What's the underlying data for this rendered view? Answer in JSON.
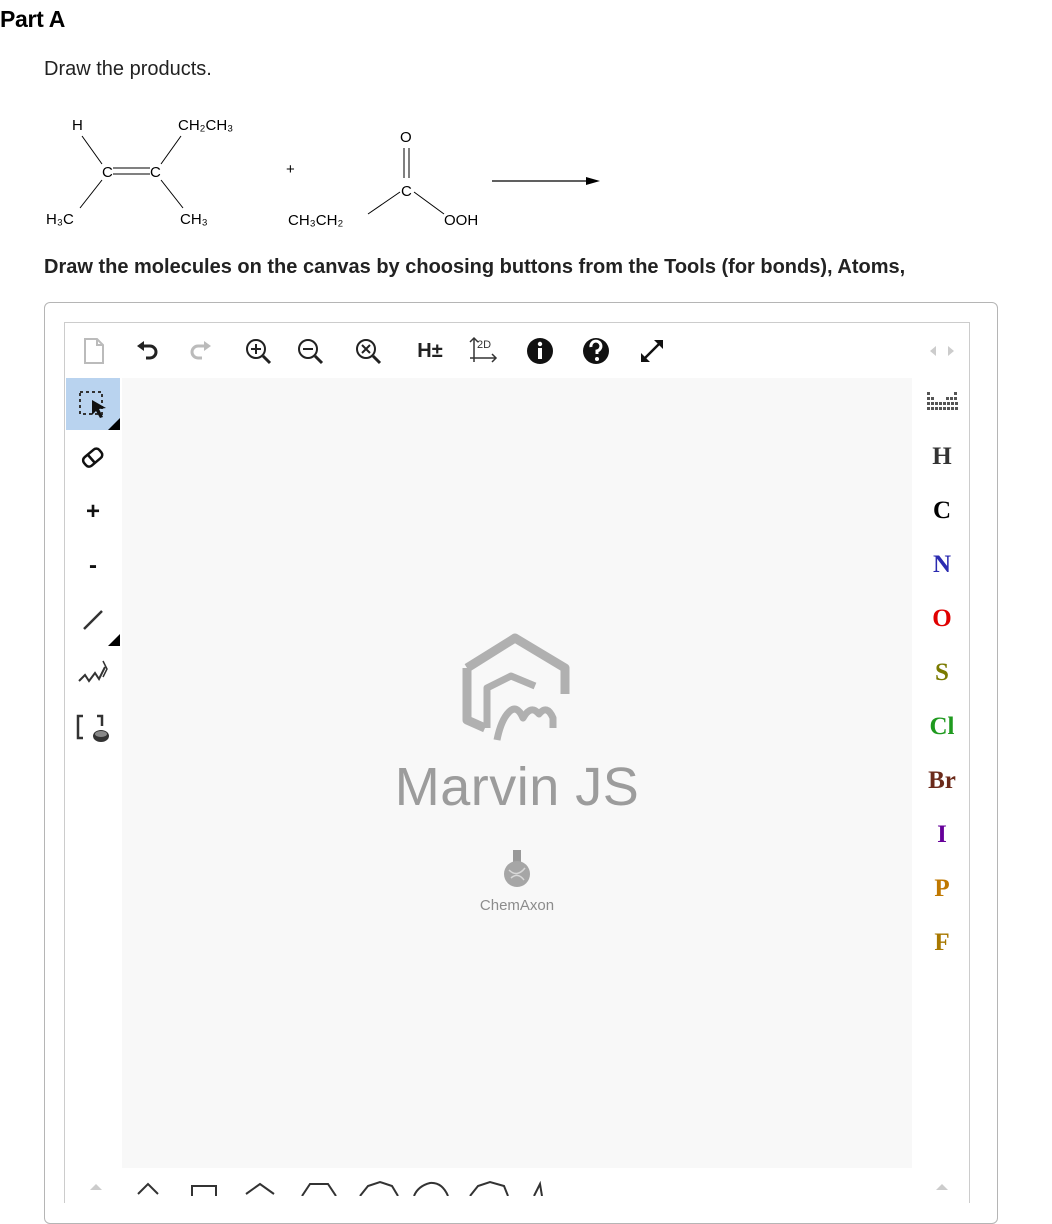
{
  "part": {
    "title": "Part A"
  },
  "question": {
    "prompt": "Draw the products.",
    "instructions": "Draw the molecules on the canvas by choosing buttons from the Tools (for bonds), Atoms,"
  },
  "reaction": {
    "alkene": {
      "h": "H",
      "ch2ch3": "CH₂CH₃",
      "h3c": "H₃C",
      "ch3": "CH₃",
      "c_left": "C",
      "c_right": "C"
    },
    "plus": "+",
    "acid": {
      "o": "O",
      "c": "C",
      "ch3ch2": "CH₃CH₂",
      "ooh": "OOH"
    }
  },
  "editor": {
    "top_tools": [
      "new-document-icon",
      "undo-icon",
      "redo-icon",
      "zoom-in-icon",
      "zoom-out-icon",
      "zoom-reset-icon",
      "h-toggle",
      "clean-2d-icon",
      "info-icon",
      "help-icon",
      "fullscreen-icon"
    ],
    "hydrogen_toggle_label": "H±",
    "clean_label": "2D",
    "left_tools": {
      "charge_plus": "+",
      "charge_minus": "-"
    },
    "watermark": {
      "title": "Marvin JS",
      "company": "ChemAxon"
    },
    "atoms": [
      {
        "symbol": "H",
        "color": "#333333"
      },
      {
        "symbol": "C",
        "color": "#000000"
      },
      {
        "symbol": "N",
        "color": "#2b2bb0"
      },
      {
        "symbol": "O",
        "color": "#e00000"
      },
      {
        "symbol": "S",
        "color": "#7a7a00"
      },
      {
        "symbol": "Cl",
        "color": "#1f9a1f"
      },
      {
        "symbol": "Br",
        "color": "#6b2a1a"
      },
      {
        "symbol": "I",
        "color": "#660099"
      },
      {
        "symbol": "P",
        "color": "#c07800"
      },
      {
        "symbol": "F",
        "color": "#a87800"
      }
    ],
    "active_tool_color": "#b9d3ef"
  }
}
